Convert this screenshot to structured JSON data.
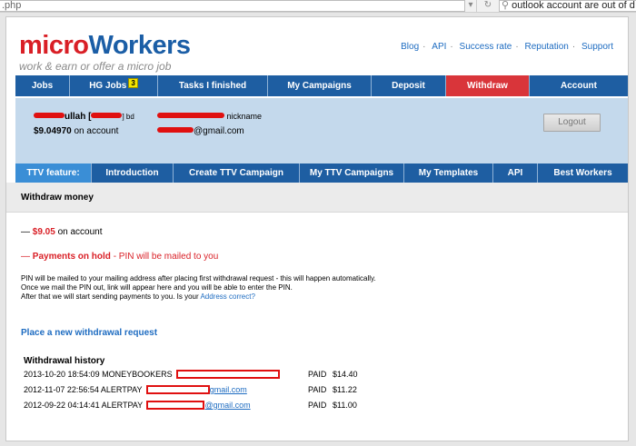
{
  "browser": {
    "url": ".php",
    "search_text": "outlook account are out of d",
    "dropdown_icon": "chevron-down-icon",
    "reload_icon": "reload-icon"
  },
  "header": {
    "logo_micro": "micro",
    "logo_workers": "Workers",
    "tagline": "work & earn or offer a micro job",
    "links": [
      "Blog",
      "API",
      "Success rate",
      "Reputation",
      "Support"
    ]
  },
  "main_nav": [
    {
      "label": "Jobs",
      "active": false
    },
    {
      "label": "HG Jobs",
      "badge": "3",
      "active": false
    },
    {
      "label": "Tasks I finished",
      "active": false
    },
    {
      "label": "My Campaigns",
      "active": false
    },
    {
      "label": "Deposit",
      "active": false
    },
    {
      "label": "Withdraw",
      "active": true
    },
    {
      "label": "Account",
      "active": false
    }
  ],
  "user": {
    "name_suffix": "ullah",
    "bracket_open": "[",
    "bracket_close": "] bd",
    "nickname_label": "nickname",
    "balance": "$9.04970",
    "balance_suffix": "on account",
    "email_suffix": "@gmail.com",
    "logout_label": "Logout"
  },
  "sub_nav": [
    {
      "label": "TTV feature:",
      "lead": true
    },
    {
      "label": "Introduction"
    },
    {
      "label": "Create TTV Campaign"
    },
    {
      "label": "My TTV Campaigns"
    },
    {
      "label": "My Templates"
    },
    {
      "label": "API"
    },
    {
      "label": "Best Workers"
    }
  ],
  "section_title": "Withdraw money",
  "balance_line": {
    "dash": "—",
    "amount": "$9.05",
    "suffix": "on account"
  },
  "hold_line": {
    "dash": "—",
    "label": "Payments on hold",
    "detail": "- PIN will be mailed to you"
  },
  "pin_text": {
    "line1": "PIN will be mailed to your mailing address after placing first withdrawal request - this will happen automatically.",
    "line2": "Once we mail the PIN out, link will appear here and you will be able to enter the PIN.",
    "line3": "After that we will start sending payments to you. Is your",
    "link": "Address correct?"
  },
  "new_withdraw_link": "Place a new withdrawal request",
  "history": {
    "title": "Withdrawal history",
    "rows": [
      {
        "datetime": "2013-10-20 18:54:09",
        "method": "MONEYBOOKERS",
        "account_suffix": "",
        "status": "PAID",
        "amount": "$14.40"
      },
      {
        "datetime": "2012-11-07 22:56:54",
        "method": "ALERTPAY",
        "account_suffix": "gmail.com",
        "status": "PAID",
        "amount": "$11.22"
      },
      {
        "datetime": "2012-09-22 04:14:41",
        "method": "ALERTPAY",
        "account_suffix": "@gmail.com",
        "status": "PAID",
        "amount": "$11.00"
      }
    ]
  },
  "colors": {
    "nav_blue": "#1e5ea2",
    "active_red": "#d9353a",
    "panel_blue": "#c4d9ec",
    "link_blue": "#1e6cc1",
    "warning_red": "#d91f26"
  }
}
